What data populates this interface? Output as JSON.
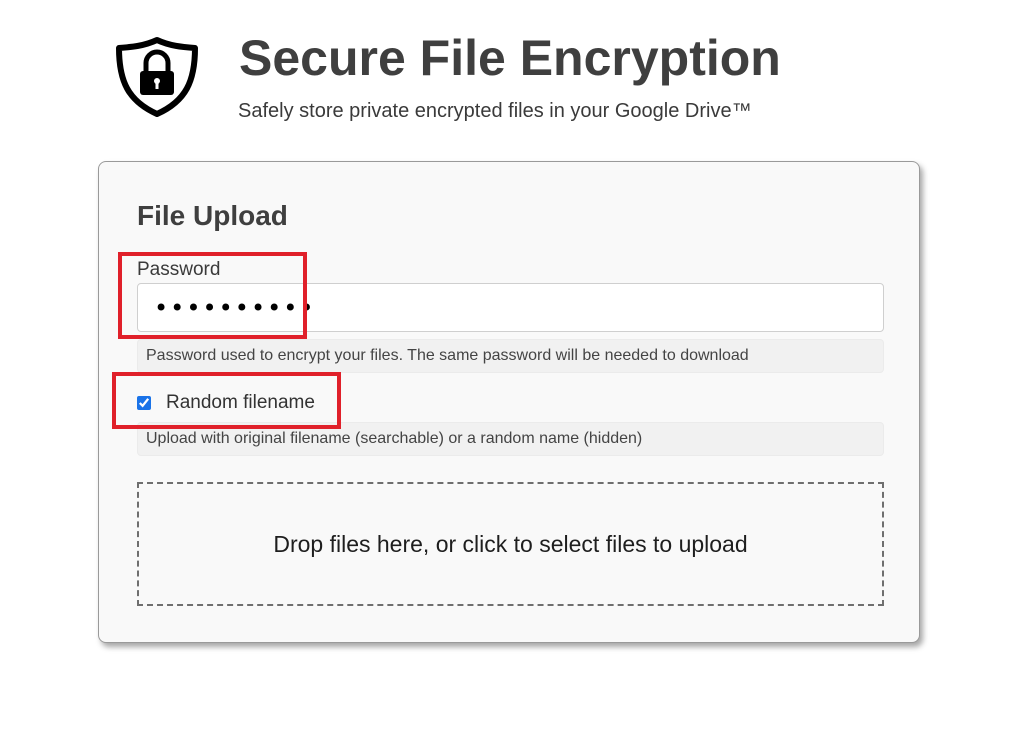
{
  "header": {
    "title": "Secure File Encryption",
    "subtitle": "Safely store private encrypted files in your Google Drive™",
    "logo_icon": "shield-lock-icon"
  },
  "upload_card": {
    "title": "File Upload",
    "password": {
      "label": "Password",
      "value": "••••••••••",
      "help": "Password used to encrypt your files. The same password will be needed to download"
    },
    "random_filename": {
      "label": "Random filename",
      "checked": true,
      "help": "Upload with original filename (searchable) or a random name (hidden)"
    },
    "dropzone": {
      "text": "Drop files here, or click to select files to upload"
    }
  },
  "colors": {
    "highlight": "#e0202a",
    "title_text": "#3f3f3f",
    "card_background": "#f9f9f9",
    "checkbox_accent": "#1a73e8"
  }
}
